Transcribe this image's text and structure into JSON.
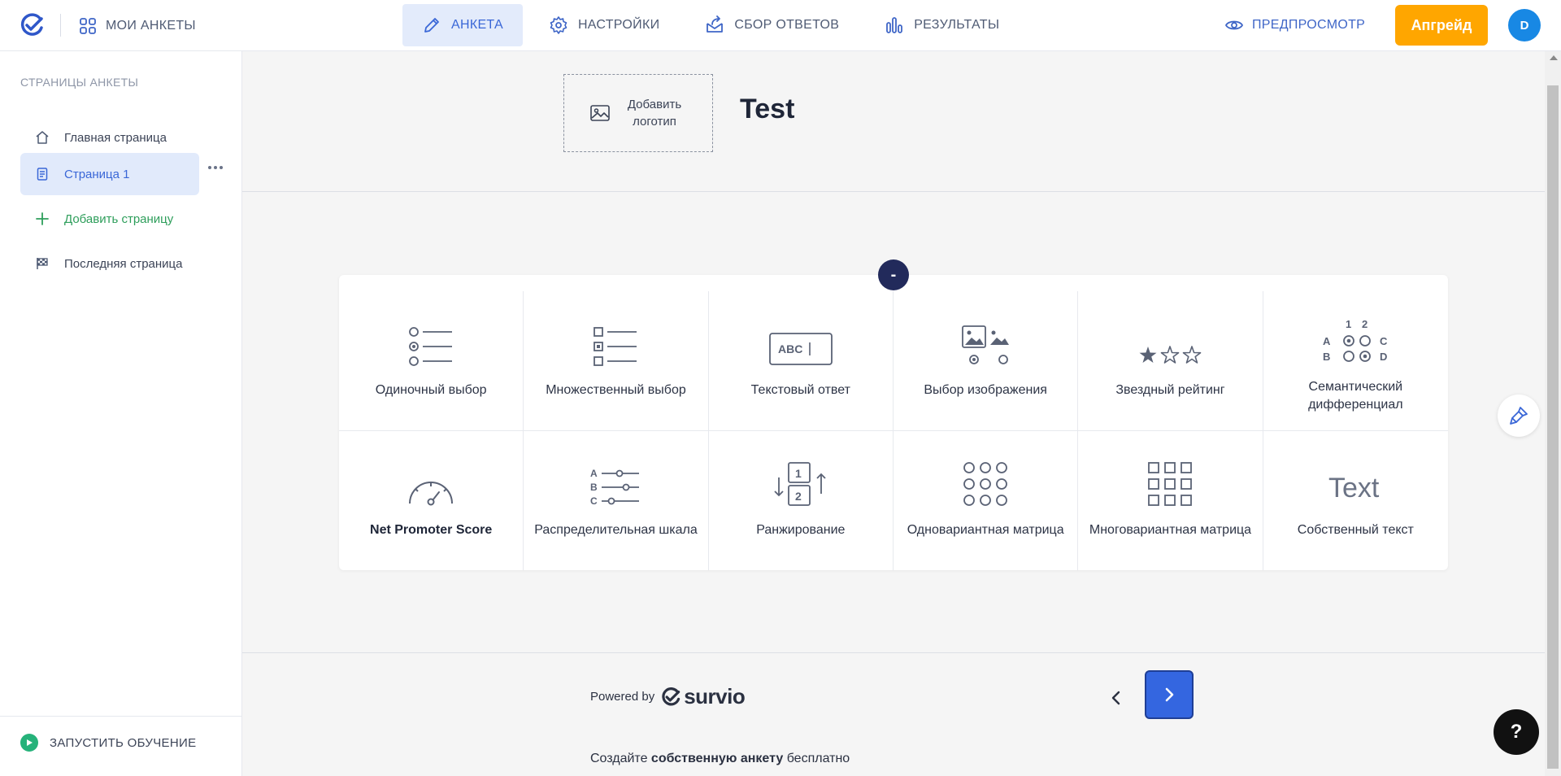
{
  "topbar": {
    "my_surveys": "МОИ АНКЕТЫ",
    "tabs": [
      {
        "label": "АНКЕТА",
        "icon": "pencil-icon",
        "active": true
      },
      {
        "label": "НАСТРОЙКИ",
        "icon": "gear-icon",
        "active": false
      },
      {
        "label": "СБОР ОТВЕТОВ",
        "icon": "share-envelope-icon",
        "active": false
      },
      {
        "label": "РЕЗУЛЬТАТЫ",
        "icon": "bar-chart-icon",
        "active": false
      }
    ],
    "preview": "ПРЕДПРОСМОТР",
    "upgrade": "Апгрейд",
    "avatar_letter": "D"
  },
  "sidebar": {
    "title": "СТРАНИЦЫ АНКЕТЫ",
    "items": [
      {
        "label": "Главная страница",
        "icon": "home-icon"
      },
      {
        "label": "Страница 1",
        "icon": "page-icon",
        "active": true
      },
      {
        "label": "Добавить страницу",
        "icon": "plus-icon"
      },
      {
        "label": "Последняя страница",
        "icon": "checkered-flag-icon"
      }
    ],
    "tutorial": "ЗАПУСТИТЬ ОБУЧЕНИЕ"
  },
  "main": {
    "add_logo": "Добавить логотип",
    "survey_title": "Test",
    "collapse_symbol": "-",
    "question_types": [
      {
        "label": "Одиночный выбор",
        "icon": "single-choice-icon"
      },
      {
        "label": "Множественный выбор",
        "icon": "multiple-choice-icon"
      },
      {
        "label": "Текстовый ответ",
        "icon": "text-answer-icon",
        "icon_text": "ABC"
      },
      {
        "label": "Выбор изображения",
        "icon": "image-choice-icon"
      },
      {
        "label": "Звездный рейтинг",
        "icon": "star-rating-icon"
      },
      {
        "label": "Семантический дифференциал",
        "icon": "semantic-differential-icon"
      },
      {
        "label": "Net Promoter Score",
        "icon": "nps-gauge-icon"
      },
      {
        "label": "Распределительная шкала",
        "icon": "distribution-scale-icon"
      },
      {
        "label": "Ранжирование",
        "icon": "ranking-icon"
      },
      {
        "label": "Одновариантная матрица",
        "icon": "single-matrix-icon"
      },
      {
        "label": "Многовариантная матрица",
        "icon": "multi-matrix-icon"
      },
      {
        "label": "Собственный текст",
        "icon": "custom-text-icon",
        "icon_text": "Text"
      }
    ],
    "powered_by": "Powered by",
    "brand": "survio",
    "create_prefix": "Создайте ",
    "create_bold": "собственную анкету",
    "create_suffix": " бесплатно",
    "help": "?"
  },
  "colors": {
    "accent": "#3a67d7",
    "upgrade": "#ffa600",
    "avatar": "#1888e4",
    "next_button": "#3466e0",
    "collapse": "#222a5b",
    "add_page": "#2e9e5b"
  }
}
